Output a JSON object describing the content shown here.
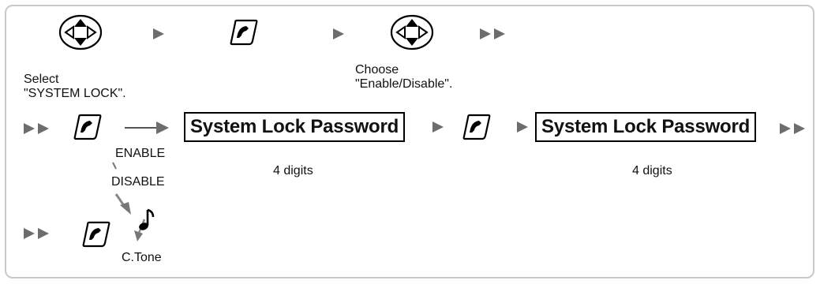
{
  "steps": {
    "select_line1": "Select",
    "select_line2": "\"SYSTEM LOCK\".",
    "choose_line1": "Choose",
    "choose_line2": "\"Enable/Disable\".",
    "enable_label": "ENABLE",
    "disable_label": "DISABLE",
    "password_box_1": "System Lock Password",
    "password_box_2": "System Lock Password",
    "digits_1": "4 digits",
    "digits_2": "4 digits",
    "ctone_label": "C.Tone"
  },
  "icons": {
    "navigator_key": "navigator-key-icon",
    "enter_key": "enter-key-icon",
    "arrow": "triangle-arrow-icon",
    "double_arrow": "double-triangle-arrow-icon",
    "tone": "musical-note-icon"
  }
}
